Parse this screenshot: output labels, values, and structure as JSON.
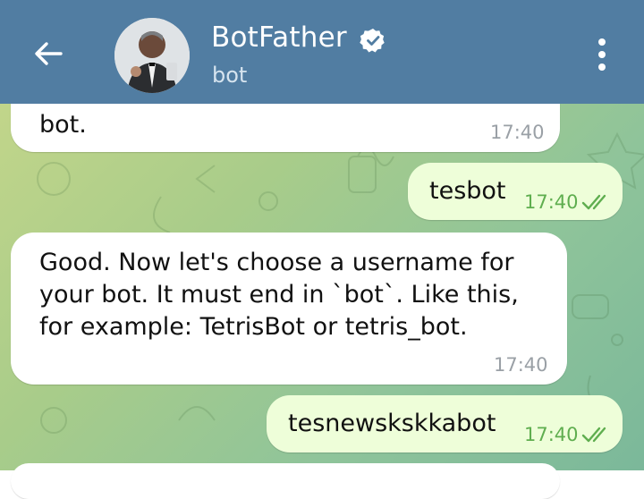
{
  "header": {
    "title": "BotFather",
    "subtitle": "bot",
    "back_icon": "arrow-left-icon",
    "verified_icon": "verified-badge-icon",
    "menu_icon": "kebab-menu-icon",
    "color": "#517da2"
  },
  "messages": [
    {
      "direction": "incoming",
      "text": "bot.",
      "time": "17:40"
    },
    {
      "direction": "outgoing",
      "text": "tesbot",
      "time": "17:40",
      "status": "read"
    },
    {
      "direction": "incoming",
      "text": "Good. Now let's choose a username for\nyour bot. It must end in `bot`. Like this,\nfor example: TetrisBot or tetris_bot.",
      "time": "17:40"
    },
    {
      "direction": "outgoing",
      "text": "tesnewskskkabot",
      "time": "17:40",
      "status": "read"
    }
  ],
  "colors": {
    "incoming_bubble": "#ffffff",
    "outgoing_bubble": "#eefed9",
    "read_checks": "#5fae4f"
  }
}
